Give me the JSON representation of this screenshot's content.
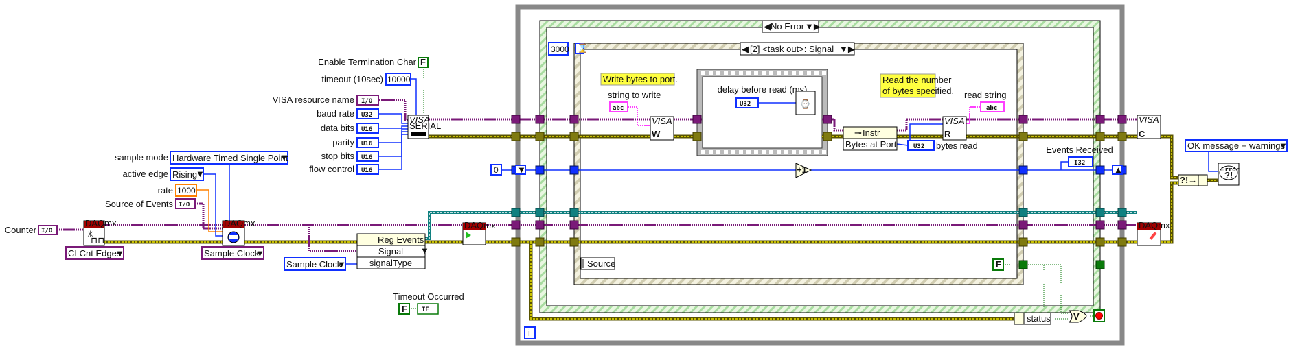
{
  "left": {
    "counter_label": "Counter",
    "counter_const": "I/O",
    "create_channel_ring": "CI Cnt Edges",
    "daqmx_label": "DAQmx",
    "sample_mode_label": "sample mode",
    "sample_mode_value": "Hardware Timed Single Point",
    "active_edge_label": "active edge",
    "active_edge_value": "Rising",
    "rate_label": "rate",
    "rate_value": "1000",
    "source_events_label": "Source of Events",
    "source_events_const": "I/O",
    "timing_ring": "Sample Clock",
    "enable_term_label": "Enable Termination Char",
    "enable_term_value": "F",
    "timeout_label": "timeout (10sec)",
    "timeout_value": "10000",
    "visa_resource_label": "VISA resource name",
    "visa_resource_const": "I/O",
    "serial_params": [
      {
        "label": "baud rate",
        "type": "U32"
      },
      {
        "label": "data bits",
        "type": "U16"
      },
      {
        "label": "parity",
        "type": "U16"
      },
      {
        "label": "stop bits",
        "type": "U16"
      },
      {
        "label": "flow control",
        "type": "U16"
      }
    ],
    "visa_serial_node": "VISA",
    "visa_serial_sub": "SERIAL",
    "reg_events_title": "Reg Events",
    "reg_events_row1": "Signal",
    "reg_events_row2": "signalType",
    "reg_events_ring": "Sample Clock",
    "timeout_occurred_label": "Timeout Occurred",
    "timeout_occurred_const": "F",
    "timeout_occurred_ind": "TF"
  },
  "loop": {
    "case_selector": "No Error",
    "event_timeout": "3000",
    "event_selector": "[2] <task out>: Signal",
    "comment_write": "Write bytes to port.",
    "string_to_write_label": "string to write",
    "string_const": "abc",
    "visa_write_node": "VISA",
    "delay_label": "delay before read (ms)",
    "delay_type": "U32",
    "property_node_title": "Instr",
    "property_node_row": "Bytes at Port",
    "bytes_read_type": "U32",
    "bytes_read_label": "bytes read",
    "comment_read_1": "Read the number",
    "comment_read_2": "of bytes specified.",
    "read_string_label": "read string",
    "read_string_ind": "abc",
    "visa_read_node": "VISA",
    "init_count": "0",
    "increment": "+1",
    "events_received_label": "Events Received",
    "events_received_type": "I32",
    "source_node": "Source",
    "stop_const": "F",
    "status_label": "status",
    "or_label": "V",
    "iteration_label": "i"
  },
  "right": {
    "visa_close_node": "VISA",
    "daqmx_clear_node": "DAQmx",
    "error_ring": "OK message + warnings",
    "error_handler": "Error"
  },
  "colors": {
    "visa_wire": "#7a1a78",
    "error_wire": "#c8c000",
    "numeric_wire": "#1030ff",
    "event_wire": "#108080",
    "bool_wire": "#0a7a0a",
    "string_wire": "#ff40ff",
    "daqmx_header": "#a00000",
    "comment_bg": "#ffff40"
  }
}
